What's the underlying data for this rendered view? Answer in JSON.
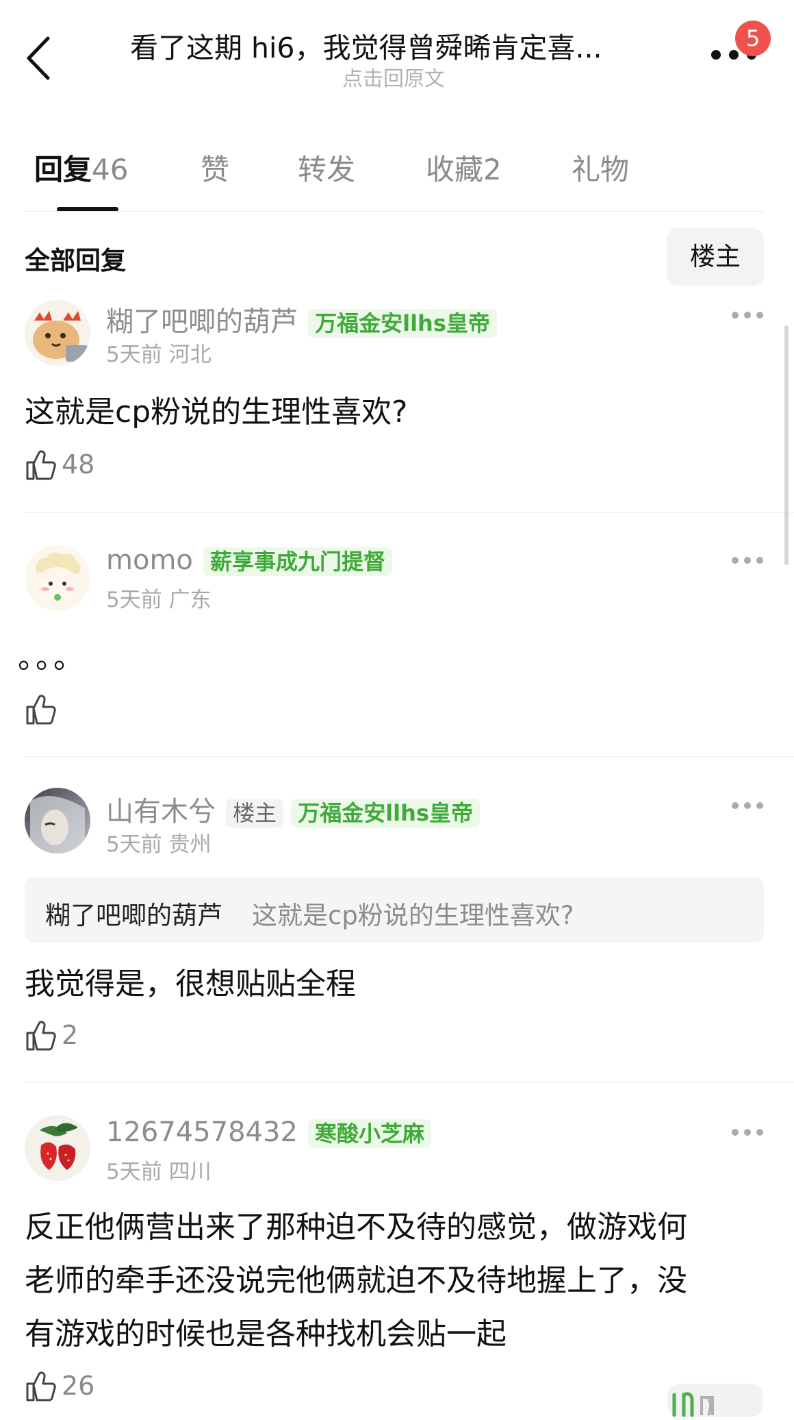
{
  "header": {
    "title": "看了这期 hi6，我觉得曾舜晞肯定喜...",
    "subtitle": "点击回原文",
    "notification_count": "5",
    "back_icon": "chevron-left-icon",
    "more_icon": "more-dots-icon"
  },
  "tabs": [
    {
      "label": "回复",
      "count": "46",
      "active": true
    },
    {
      "label": "赞",
      "count": ""
    },
    {
      "label": "转发",
      "count": ""
    },
    {
      "label": "收藏",
      "count": "2"
    },
    {
      "label": "礼物",
      "count": ""
    }
  ],
  "section": {
    "label": "全部回复",
    "filter_button": "楼主"
  },
  "comments": [
    {
      "username": "糊了吧唧的葫芦",
      "badges": [
        "万福金安llhs皇帝"
      ],
      "time": "5天前",
      "location": "河北",
      "body": "这就是cp粉说的生理性喜欢?",
      "likes": "48"
    },
    {
      "username": "momo",
      "badges": [
        "薪享事成九门提督"
      ],
      "time": "5天前",
      "location": "广东",
      "body": "。。。",
      "likes": ""
    },
    {
      "username": "山有木兮",
      "op_label": "楼主",
      "badges": [
        "万福金安llhs皇帝"
      ],
      "time": "5天前",
      "location": "贵州",
      "quote": {
        "author": "糊了吧唧的葫芦",
        "text": "这就是cp粉说的生理性喜欢?"
      },
      "body": "我觉得是，很想贴贴全程",
      "likes": "2"
    },
    {
      "username": "12674578432",
      "badges": [
        "寒酸小芝麻"
      ],
      "time": "5天前",
      "location": "四川",
      "body_lines": [
        "反正他俩营出来了那种迫不及待的感觉，做游戏何",
        "老师的牵手还没说完他俩就迫不及待地握上了，没",
        "有游戏的时候也是各种找机会贴一起"
      ],
      "likes": "26"
    }
  ],
  "colors": {
    "badge_green": "#3faa3a",
    "badge_bg": "#ecf8e8",
    "notification_red": "#f0514d",
    "muted_text": "#8c8c8c"
  }
}
